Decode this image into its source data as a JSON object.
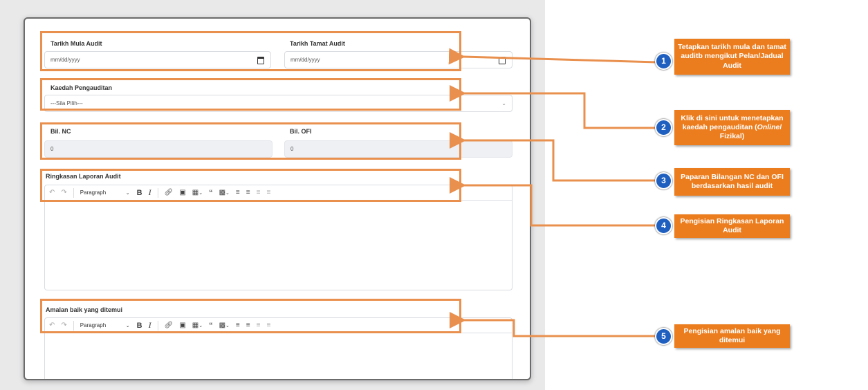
{
  "form": {
    "start_date": {
      "label": "Tarikh Mula Audit",
      "placeholder": "mm/dd/yyyy"
    },
    "end_date": {
      "label": "Tarikh Tamat Audit",
      "placeholder": "mm/dd/yyyy"
    },
    "method": {
      "label": "Kaedah Pengauditan",
      "selected": "---Sila Pilih---"
    },
    "nc": {
      "label": "Bil. NC",
      "value": "0"
    },
    "ofi": {
      "label": "Bil. OFI",
      "value": "0"
    },
    "summary": {
      "label": "Ringkasan Laporan Audit",
      "format": "Paragraph"
    },
    "good_practice": {
      "label": "Amalan baik yang ditemui",
      "format": "Paragraph"
    }
  },
  "callouts": [
    {
      "number": "1",
      "text": "Tetapkan tarikh mula dan tamat auditb mengikut Pelan/Jadual Audit"
    },
    {
      "number": "2",
      "text_before": "Klik  di sini untuk menetapkan kaedah pengauditan (",
      "text_italic": "Online",
      "text_after": "/ Fizikal)"
    },
    {
      "number": "3",
      "text": "Paparan Bilangan NC dan OFI berdasarkan hasil audit"
    },
    {
      "number": "4",
      "text": "Pengisian Ringkasan Laporan Audit"
    },
    {
      "number": "5",
      "text": "Pengisian amalan baik yang ditemui"
    }
  ],
  "colors": {
    "highlight": "#e9904e",
    "callout": "#ec7d1e",
    "badge": "#1f5fbf"
  }
}
